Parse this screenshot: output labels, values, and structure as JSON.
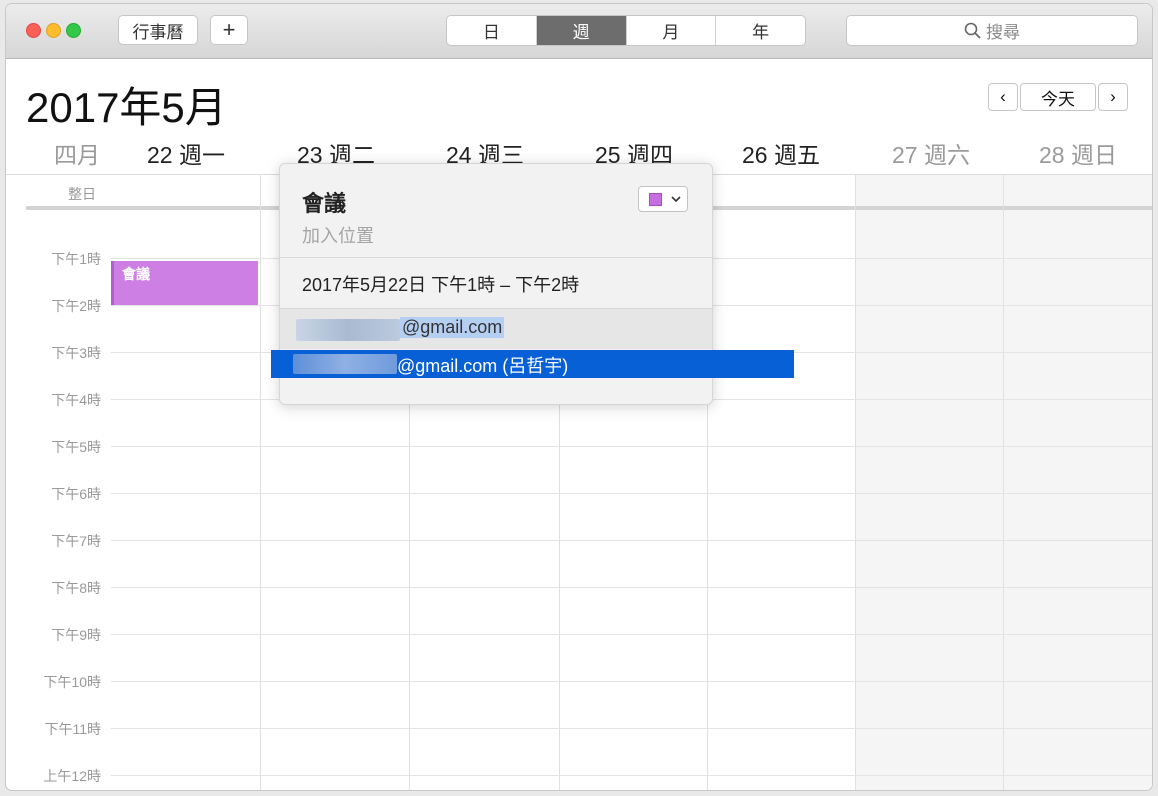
{
  "toolbar": {
    "calendars_label": "行事曆",
    "add_label": "+",
    "views": [
      {
        "label": "日",
        "active": false
      },
      {
        "label": "週",
        "active": true
      },
      {
        "label": "月",
        "active": false
      },
      {
        "label": "年",
        "active": false
      }
    ],
    "search_placeholder": "搜尋",
    "search_icon": "magnifier-icon"
  },
  "header": {
    "month_title": "2017年5月",
    "prev_icon": "‹",
    "today_label": "今天",
    "next_icon": "›"
  },
  "days": [
    {
      "label": "四月",
      "dim": true
    },
    {
      "label": "22 週一",
      "dim": false
    },
    {
      "label": "23 週二",
      "dim": false
    },
    {
      "label": "24 週三",
      "dim": false
    },
    {
      "label": "25 週四",
      "dim": false
    },
    {
      "label": "26 週五",
      "dim": false
    },
    {
      "label": "27 週六",
      "dim": true
    },
    {
      "label": "28 週日",
      "dim": true
    }
  ],
  "all_day_label": "整日",
  "hours": [
    "下午1時",
    "下午2時",
    "下午3時",
    "下午4時",
    "下午5時",
    "下午6時",
    "下午7時",
    "下午8時",
    "下午9時",
    "下午10時",
    "下午11時",
    "上午12時"
  ],
  "event": {
    "title": "會議",
    "color": "#cd7fe3"
  },
  "popover": {
    "title": "會議",
    "location_placeholder": "加入位置",
    "datetime": "2017年5月22日  下午1時 – 下午2時",
    "calendar_color": "#c46ee0",
    "invitee_typed": "@gmail.com",
    "suggestion": "@gmail.com (呂哲宇)"
  },
  "colors": {
    "accent": "#0860d6",
    "event": "#cd7fe3",
    "weekend_bg": "#f5f5f5"
  }
}
